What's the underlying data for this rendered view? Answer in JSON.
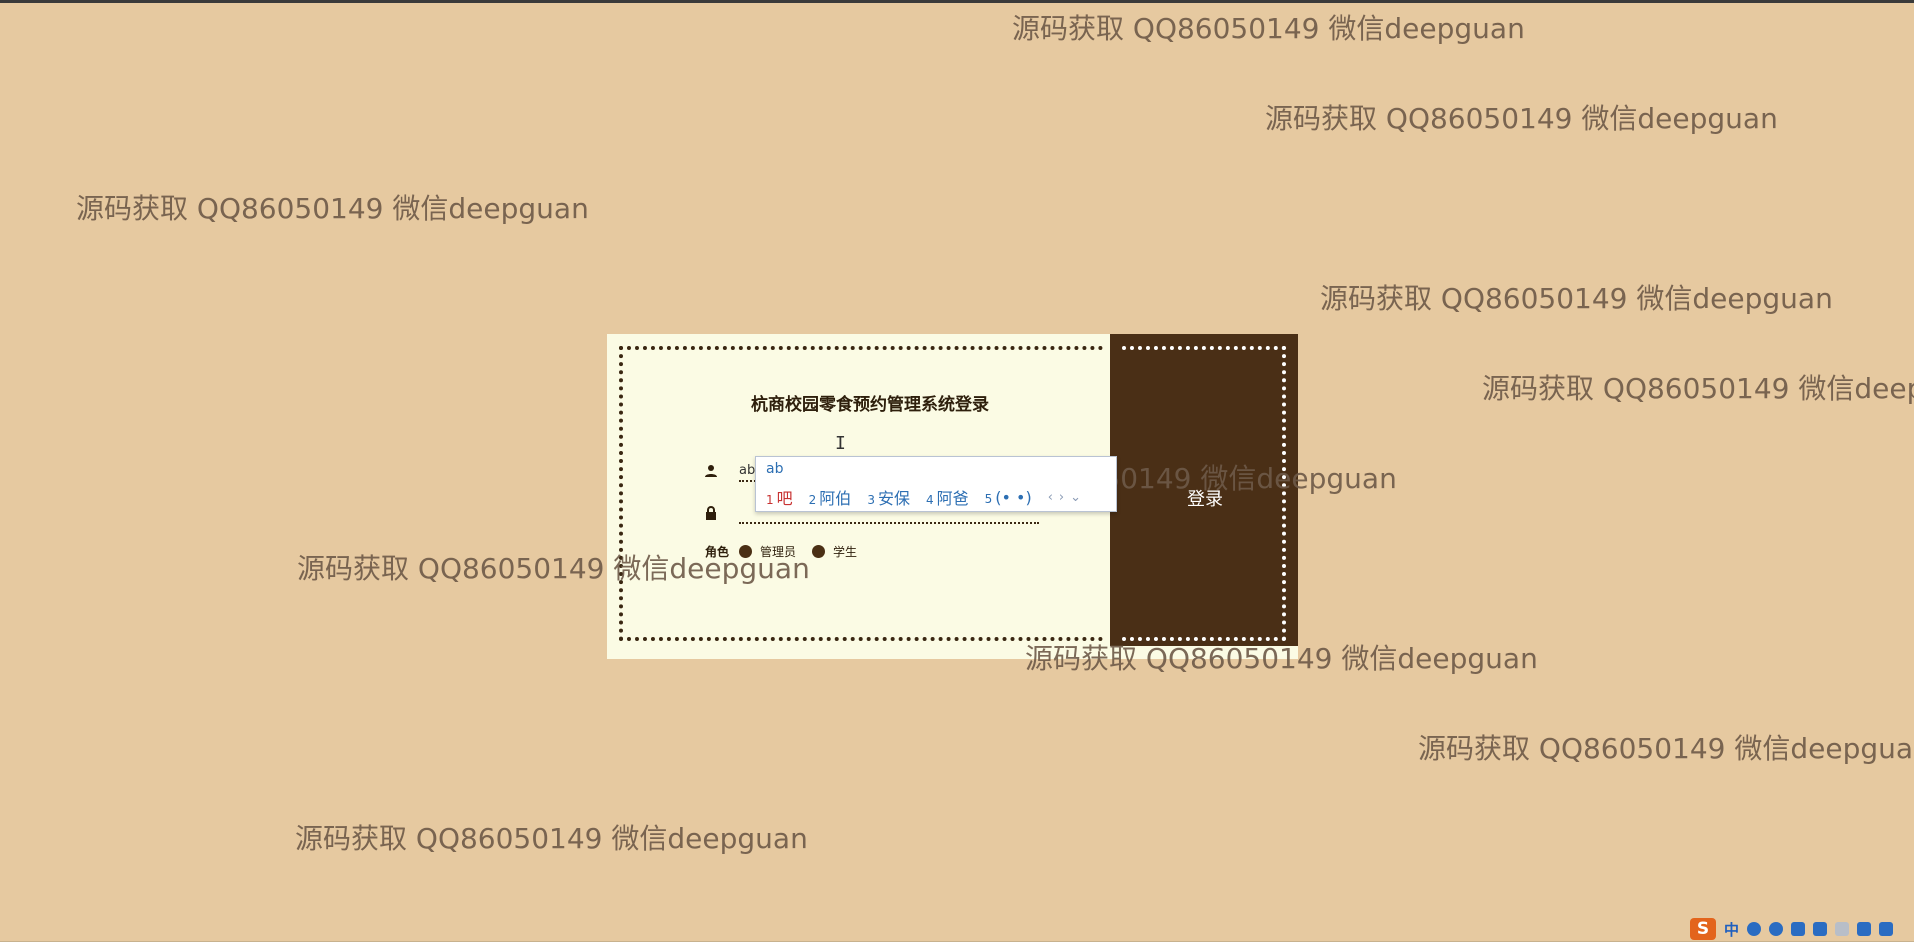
{
  "login": {
    "title": "杭商校园零食预约管理系统登录",
    "username_value": "ab",
    "password_value": "",
    "role_label": "角色",
    "roles": [
      "管理员",
      "学生"
    ],
    "submit_label": "登录"
  },
  "ime": {
    "composition": "ab",
    "candidates": [
      {
        "index": "1",
        "text": "吧"
      },
      {
        "index": "2",
        "text": "阿伯"
      },
      {
        "index": "3",
        "text": "安保"
      },
      {
        "index": "4",
        "text": "阿爸"
      },
      {
        "index": "5",
        "text": "(• •)"
      }
    ],
    "nav_prev": "‹",
    "nav_next": "›",
    "nav_expand": "⌄"
  },
  "watermark_text": "源码获取 QQ86050149 微信deepguan",
  "tray": {
    "logo": "S",
    "lang": "中"
  },
  "colors": {
    "background": "#e6c9a0",
    "card": "#fbfbe4",
    "side_panel": "#4a2f16",
    "watermark": "#6e5a48"
  }
}
